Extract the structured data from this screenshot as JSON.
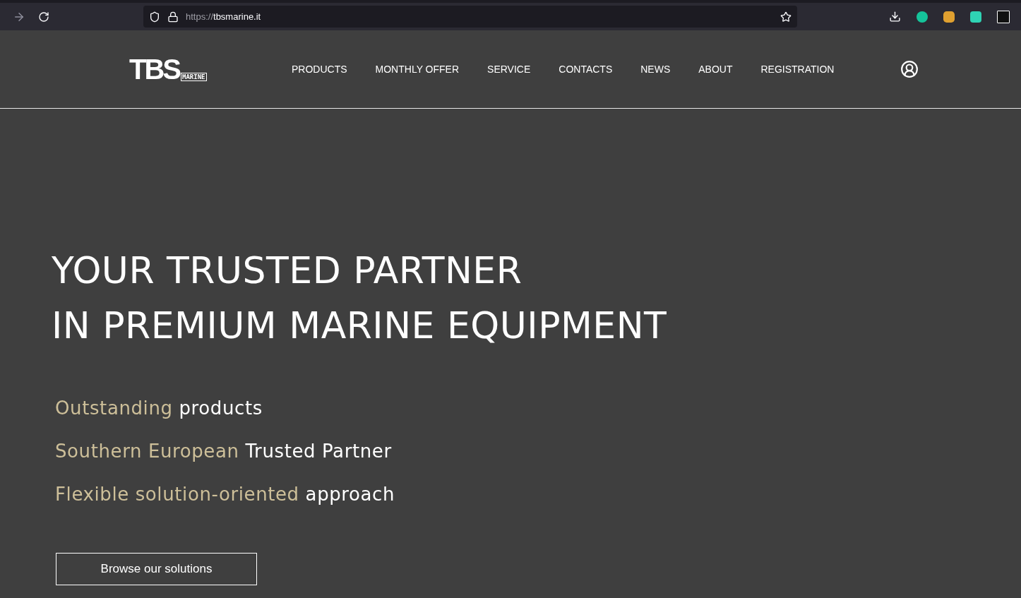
{
  "browser": {
    "url": {
      "scheme": "https://",
      "host": "tbsmarine.it"
    }
  },
  "header": {
    "logo": {
      "letters": "TBS",
      "sub": "MARINE"
    },
    "nav": [
      {
        "label": "PRODUCTS"
      },
      {
        "label": "MONTHLY OFFER"
      },
      {
        "label": "SERVICE"
      },
      {
        "label": "CONTACTS"
      },
      {
        "label": "NEWS"
      },
      {
        "label": "ABOUT"
      },
      {
        "label": "REGISTRATION"
      }
    ]
  },
  "hero": {
    "title": [
      "YOUR TRUSTED PARTNER",
      "IN PREMIUM MARINE EQUIPMENT"
    ],
    "points": [
      {
        "accent": "Outstanding",
        "rest": "products"
      },
      {
        "accent": "Southern European",
        "rest": "Trusted Partner"
      },
      {
        "accent": "Flexible solution-oriented",
        "rest": "approach"
      }
    ],
    "button": "Browse our solutions"
  }
}
